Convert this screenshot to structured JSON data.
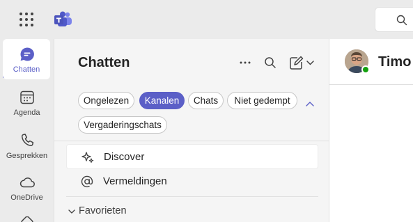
{
  "app": {
    "accent": "#5b5fc7",
    "presence_color": "#13a10e"
  },
  "rail": {
    "items": [
      {
        "label": "Chatten",
        "icon": "chat-icon",
        "active": true
      },
      {
        "label": "Agenda",
        "icon": "calendar-icon",
        "active": false
      },
      {
        "label": "Gesprekken",
        "icon": "phone-icon",
        "active": false
      },
      {
        "label": "OneDrive",
        "icon": "cloud-icon",
        "active": false
      }
    ]
  },
  "panel": {
    "title": "Chatten",
    "filters": [
      {
        "label": "Ongelezen",
        "active": false
      },
      {
        "label": "Kanalen",
        "active": true
      },
      {
        "label": "Chats",
        "active": false
      },
      {
        "label": "Niet gedempt",
        "active": false
      },
      {
        "label": "Vergaderingschats",
        "active": false
      }
    ],
    "items": [
      {
        "label": "Discover",
        "icon": "sparkle-icon"
      },
      {
        "label": "Vermeldingen",
        "icon": "at-sign-icon"
      }
    ],
    "section": {
      "label": "Favorieten",
      "expanded": true
    }
  },
  "conversation": {
    "name": "Timo"
  }
}
